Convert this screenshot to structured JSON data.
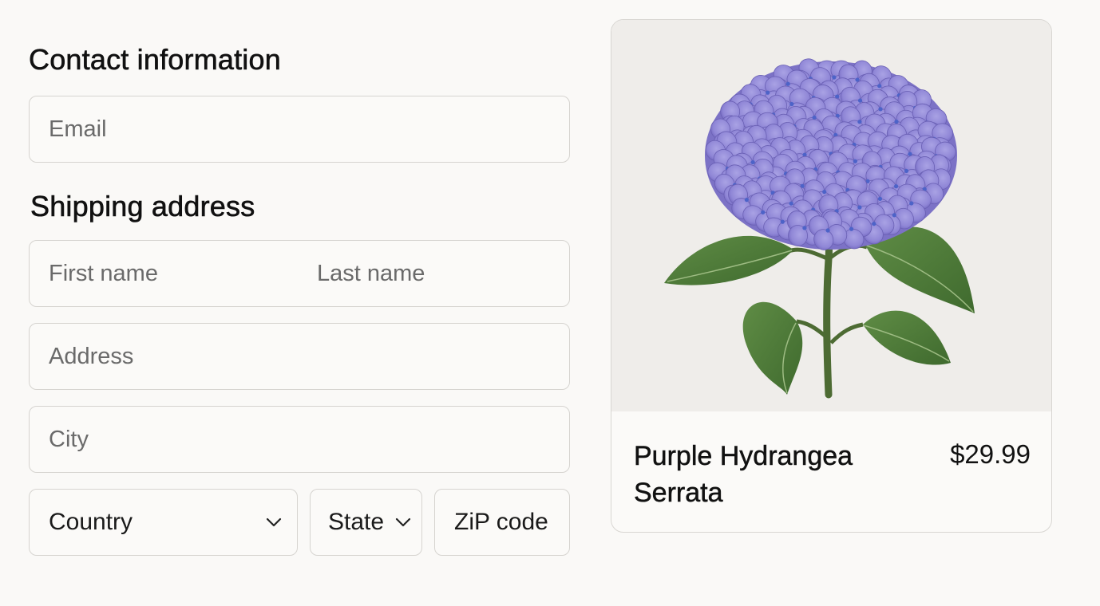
{
  "contact": {
    "heading": "Contact information",
    "email_placeholder": "Email"
  },
  "shipping": {
    "heading": "Shipping address",
    "first_name_placeholder": "First name",
    "last_name_placeholder": "Last name",
    "address_placeholder": "Address",
    "city_placeholder": "City",
    "country_selected": "Country",
    "state_selected": "State",
    "zip_placeholder": "ZiP code"
  },
  "product": {
    "name": "Purple Hydrangea Serrata",
    "price": "$29.99",
    "image": "hydrangea-illustration"
  },
  "colors": {
    "page_background": "#faf9f7",
    "border": "#d6d4d0",
    "flower": "#8f86d6",
    "leaf": "#4f7a38"
  }
}
